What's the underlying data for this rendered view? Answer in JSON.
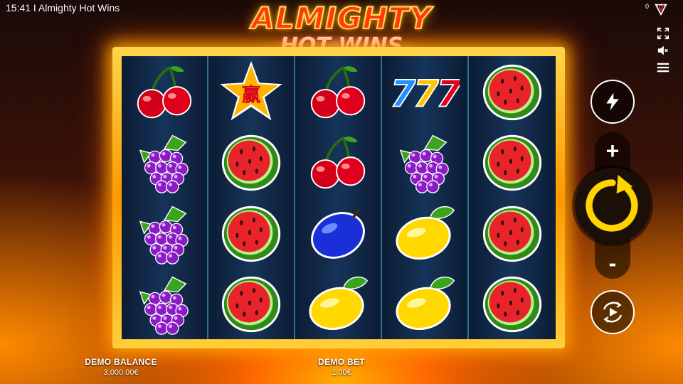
{
  "status_bar": {
    "title": "15:41 I Almighty Hot Wins",
    "counter": "0"
  },
  "logo": {
    "line1": "ALMIGHTY",
    "line2": "HOT WINS"
  },
  "icons": {
    "brand": "brand-logo-icon",
    "fullscreen": "fullscreen-icon",
    "sound": "sound-muted-icon",
    "menu": "hamburger-menu-icon",
    "turbo": "lightning-icon",
    "spin": "spin-arrow-icon",
    "autoplay": "autoplay-icon"
  },
  "reels": [
    [
      "cherry",
      "grapes",
      "grapes",
      "grapes"
    ],
    [
      "star",
      "watermelon",
      "watermelon",
      "watermelon"
    ],
    [
      "cherry",
      "cherry",
      "plum",
      "lemon"
    ],
    [
      "seven",
      "grapes",
      "lemon",
      "lemon"
    ],
    [
      "watermelon",
      "watermelon",
      "watermelon",
      "watermelon"
    ]
  ],
  "star_glyph": "赢",
  "seven_glyph": "777",
  "controls": {
    "bet_increase": "+",
    "bet_decrease": "-"
  },
  "balance": {
    "label": "DEMO BALANCE",
    "value": "3,000.00€"
  },
  "bet": {
    "label": "DEMO BET",
    "value": "1.00€"
  },
  "colors": {
    "frame_gold": "#ffb800",
    "spin_ring": "#ffd400",
    "reel_divider": "#2b6f9a"
  }
}
